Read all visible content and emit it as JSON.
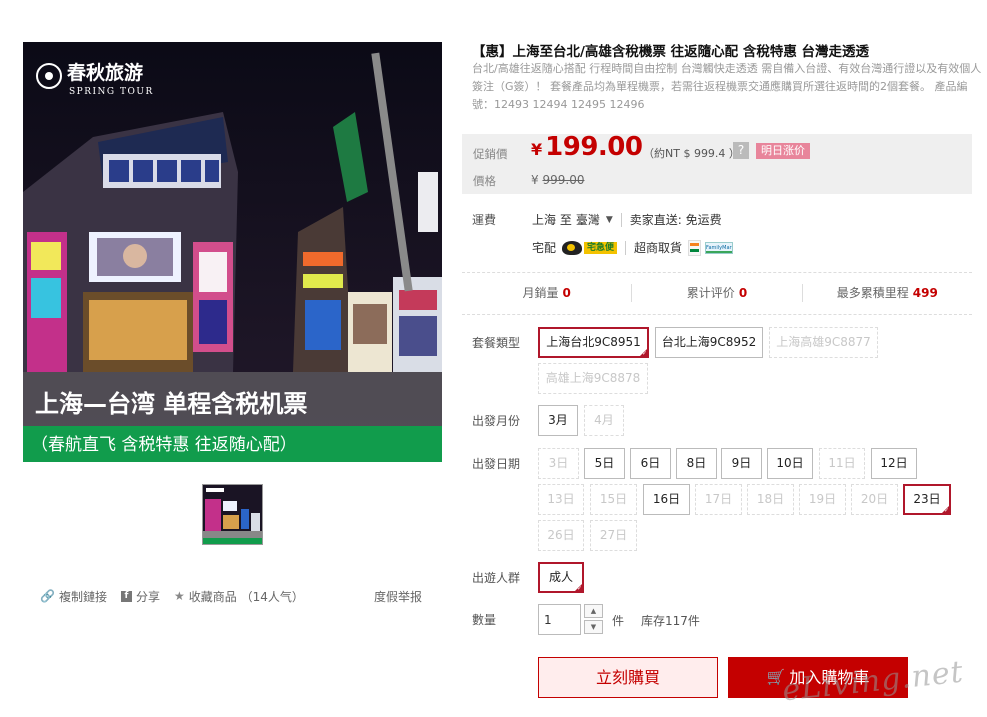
{
  "gallery": {
    "brand_name": "春秋旅游",
    "brand_name_en": "SPRING TOUR",
    "banner_main": "上海—台湾 单程含税机票",
    "banner_sub": "（春航直飞 含税特惠 往返随心配）",
    "share_actions": [
      {
        "label": "複制鏈接",
        "icon": "link-icon"
      },
      {
        "label": "分享",
        "icon": "facebook-icon"
      },
      {
        "label": "收藏商品 （14人气）",
        "icon": "star-icon"
      }
    ],
    "report_label": "度假举报"
  },
  "product": {
    "title": "【惠】上海至台北/高雄含稅機票 往返隨心配 含稅特惠 台灣走透透",
    "subtitle": "台北/高雄往返隨心搭配 行程時間自由控制 台灣觸快走透透 需自備入台證、有效台灣通行證以及有效個人簽注（G簽）！ 套餐產品均為單程機票，若需往返程機票交通應購買所選往返時間的2個套餐。 產品編號：12493 12494 12495 12496"
  },
  "price": {
    "promo_label": "促銷價",
    "currency_symbol": "¥",
    "promo_value": "199.00",
    "ntd_text": "（約NT $ 999.4 ）",
    "help_icon": "?",
    "tag": "明日涨价",
    "orig_label": "價格",
    "orig_currency": "¥",
    "orig_value": "999.00"
  },
  "shipping": {
    "label": "運費",
    "route_from": "上海 至",
    "route_to": "臺灣",
    "seller_ship": "卖家直送: 免运费",
    "delivery_label": "宅配",
    "yamato_text": "宅急便",
    "pickup_label": "超商取貨",
    "familymart_text": "FamilyMart"
  },
  "stats": [
    {
      "label": "月銷量",
      "value": "0"
    },
    {
      "label": "累计评价",
      "value": "0"
    },
    {
      "label": "最多累積里程",
      "value": "499"
    }
  ],
  "options": {
    "package_label": "套餐類型",
    "packages": [
      "上海台北9C8951",
      "台北上海9C8952",
      "上海高雄9C8877",
      "高雄上海9C8878"
    ],
    "month_label": "出發月份",
    "months": [
      "3月",
      "4月"
    ],
    "date_label": "出發日期",
    "dates": [
      "3日",
      "5日",
      "6日",
      "8日",
      "9日",
      "10日",
      "11日",
      "12日",
      "13日",
      "15日",
      "16日",
      "17日",
      "18日",
      "19日",
      "20日",
      "23日",
      "26日",
      "27日"
    ],
    "people_label": "出遊人群",
    "people": [
      "成人"
    ],
    "qty_label": "數量",
    "qty_value": "1",
    "qty_up": "▲",
    "qty_down": "▼",
    "unit": "件",
    "stock": "库存117件"
  },
  "actions": {
    "buy_now": "立刻購買",
    "add_to_cart": "加入購物車",
    "cart_icon": "🛒"
  },
  "watermark": "eLiving.net"
}
